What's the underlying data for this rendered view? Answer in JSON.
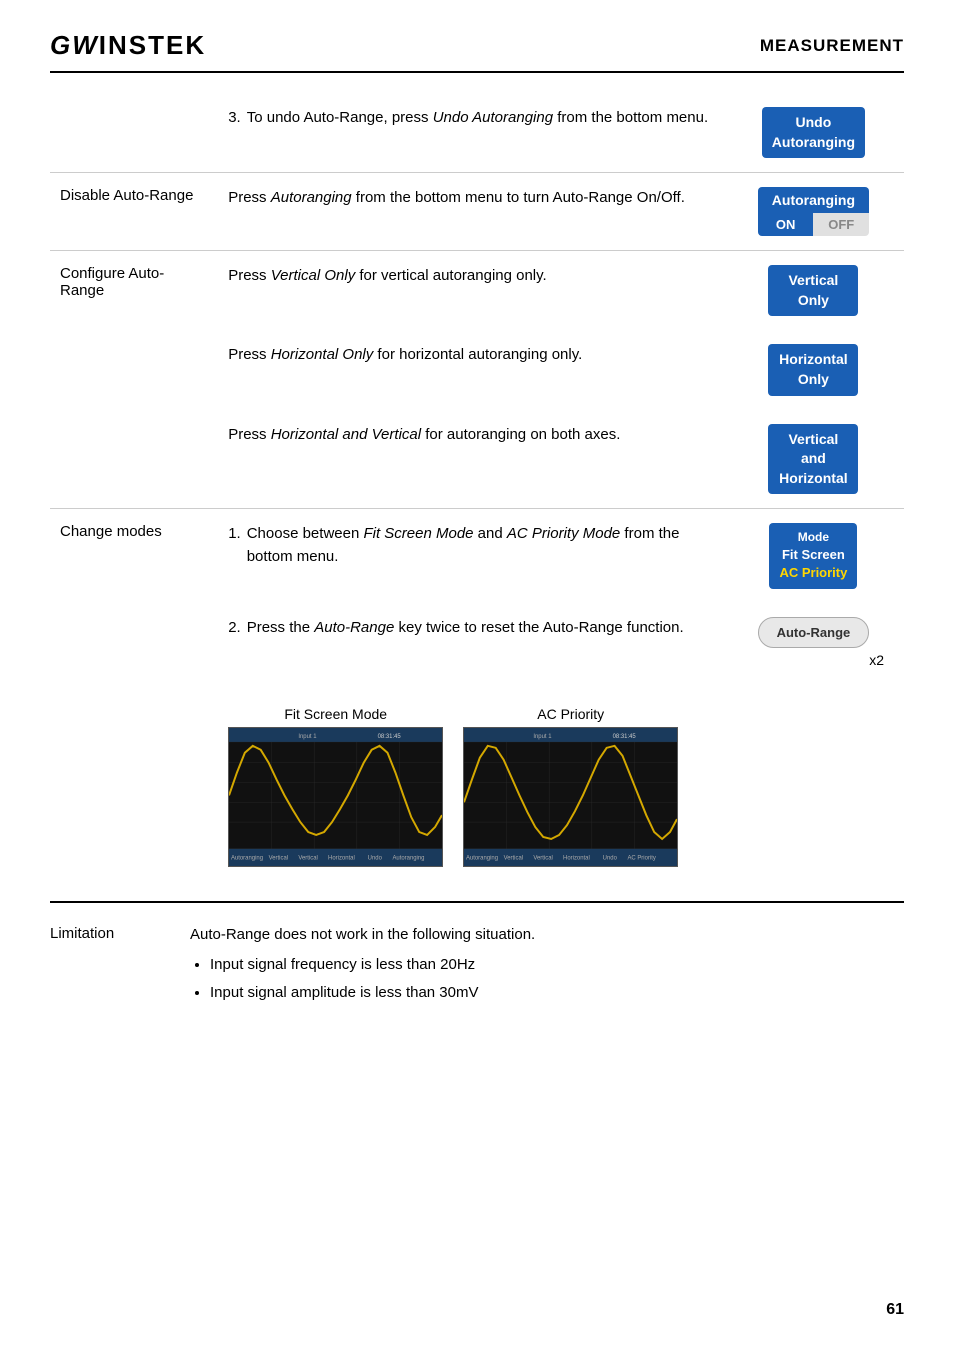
{
  "header": {
    "logo_gw": "GW",
    "logo_text": "INSTEK",
    "section_title": "MEASUREMENT"
  },
  "rows": [
    {
      "id": "undo-autoranging",
      "label": "",
      "description_numbered": "3. To undo Auto-Range, press <em>Undo Autoranging</em> from the bottom menu.",
      "button_type": "blue",
      "button_lines": [
        "Undo",
        "Autoranging"
      ]
    },
    {
      "id": "disable-auto-range",
      "label": "Disable Auto-Range",
      "description": "Press <em>Autoranging</em> from the bottom menu to turn Auto-Range On/Off.",
      "button_type": "autoranging-toggle",
      "button_top": "Autoranging",
      "button_on": "ON",
      "button_off": "OFF"
    },
    {
      "id": "configure-auto-range-vertical",
      "label": "Configure Auto-Range",
      "description": "Press <em>Vertical Only</em> for vertical autoranging only.",
      "button_type": "blue",
      "button_lines": [
        "Vertical",
        "Only"
      ]
    },
    {
      "id": "configure-auto-range-horizontal",
      "label": "",
      "description": "Press <em>Horizontal Only</em> for horizontal autoranging only.",
      "button_type": "blue",
      "button_lines": [
        "Horizontal",
        "Only"
      ]
    },
    {
      "id": "configure-auto-range-both",
      "label": "",
      "description": "Press <em>Horizontal and Vertical</em> for autoranging on both axes.",
      "button_type": "blue",
      "button_lines": [
        "Vertical",
        "and",
        "Horizontal"
      ]
    },
    {
      "id": "change-modes-1",
      "label": "Change modes",
      "description_numbered": "1. Choose between <em>Fit Screen Mode</em> and <em>AC Priority Mode</em> from the bottom menu.",
      "button_type": "mode",
      "button_mode_lines": [
        "Mode",
        "Fit Screen",
        "AC Priority"
      ]
    },
    {
      "id": "change-modes-2",
      "label": "",
      "description_numbered": "2. Press the <em>Auto-Range</em> key twice to reset the Auto-Range function.",
      "button_type": "autorange-oval",
      "button_text": "Auto-Range",
      "x2": "x2"
    }
  ],
  "screens": {
    "fit_screen_label": "Fit Screen Mode",
    "ac_priority_label": "AC Priority"
  },
  "limitation": {
    "label": "Limitation",
    "intro": "Auto-Range does not work in the following situation.",
    "items": [
      "Input signal frequency  is less than 20Hz",
      "Input signal amplitude is less than 30mV"
    ]
  },
  "page_number": "61"
}
